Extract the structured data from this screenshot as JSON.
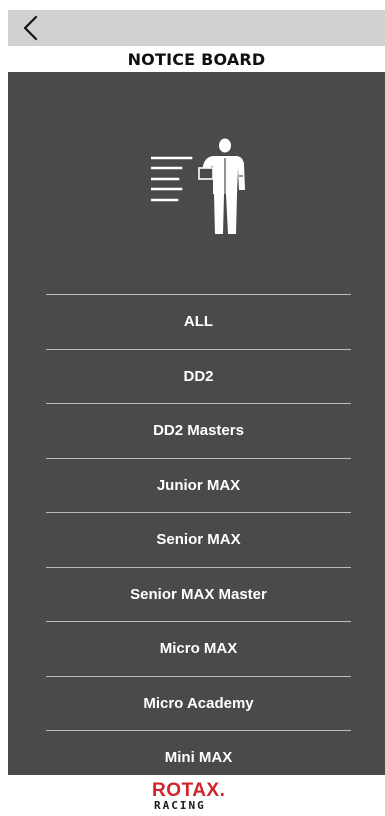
{
  "header": {
    "back_icon": "chevron-left-icon",
    "title": "NOTICE BOARD"
  },
  "hero": {
    "icon": "mechanic-notice-icon"
  },
  "categories": [
    {
      "label": "ALL"
    },
    {
      "label": "DD2"
    },
    {
      "label": "DD2 Masters"
    },
    {
      "label": "Junior MAX"
    },
    {
      "label": "Senior MAX"
    },
    {
      "label": "Senior MAX Master"
    },
    {
      "label": "Micro MAX"
    },
    {
      "label": "Micro Academy"
    },
    {
      "label": "Mini MAX"
    }
  ],
  "footer": {
    "logo_top": "ROTAX",
    "logo_bottom": "RACING"
  },
  "colors": {
    "topbar": "#d1d1d1",
    "panel": "#4a4a4a",
    "divider": "#bdbdbd",
    "brand_red": "#d2232a"
  }
}
